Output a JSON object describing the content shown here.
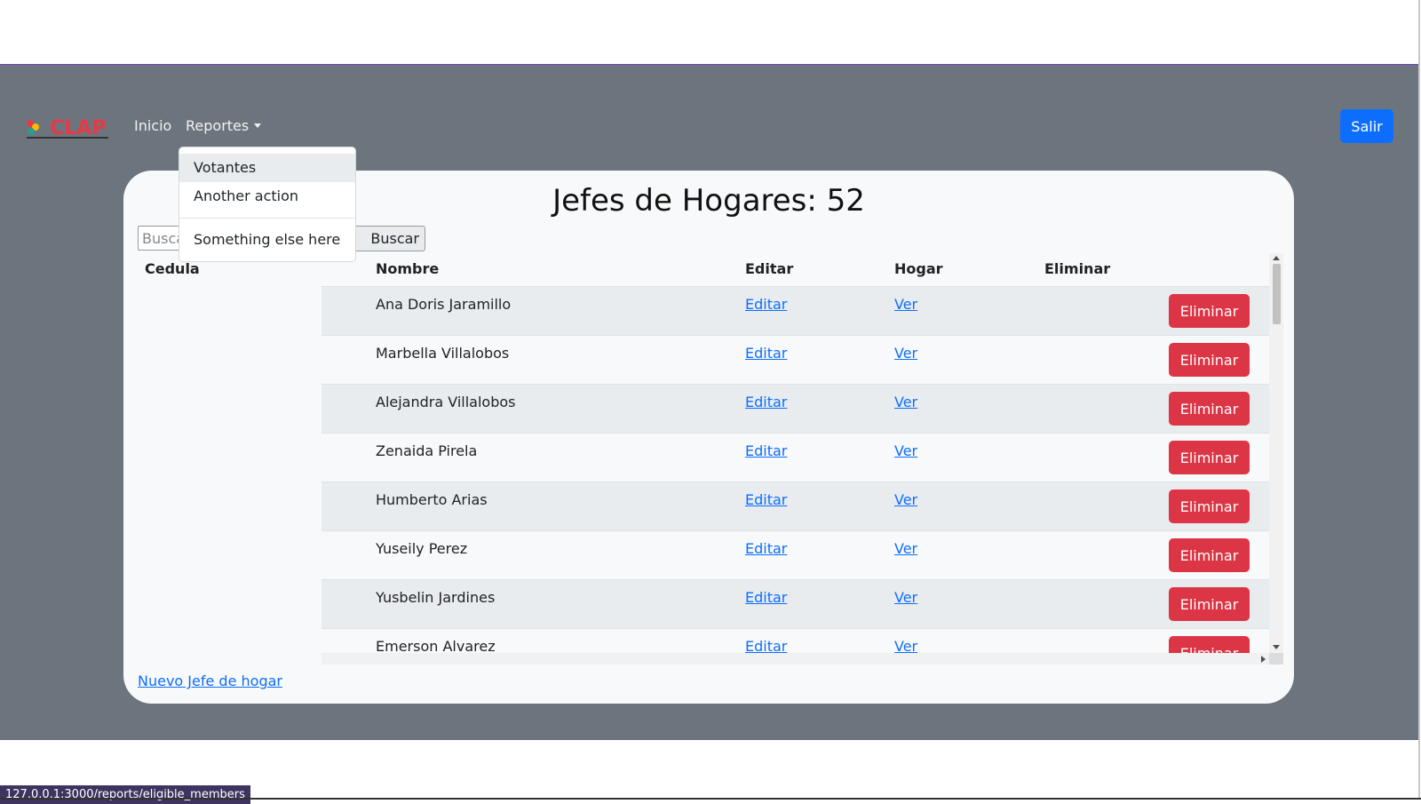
{
  "navbar": {
    "logo_text": "CLAP",
    "links": [
      {
        "label": "Inicio"
      },
      {
        "label": "Reportes"
      }
    ],
    "logout_label": "Salir"
  },
  "dropdown": {
    "items": [
      {
        "label": "Votantes"
      },
      {
        "label": "Another action"
      },
      {
        "label": "Something else here"
      }
    ]
  },
  "main": {
    "title": "Jefes de Hogares: 52",
    "search_placeholder": "Buscar",
    "search_button_label": "Buscar",
    "new_link_label": "Nuevo Jefe de hogar"
  },
  "table": {
    "columns": [
      "Cedula",
      "Nombre",
      "Editar",
      "Hogar",
      "Eliminar"
    ],
    "rows": [
      {
        "cedula": "",
        "nombre": "Ana Doris Jaramillo",
        "editar": "Editar",
        "hogar": "Ver",
        "eliminar": "Eliminar"
      },
      {
        "cedula": "",
        "nombre": "Marbella Villalobos",
        "editar": "Editar",
        "hogar": "Ver",
        "eliminar": "Eliminar"
      },
      {
        "cedula": "",
        "nombre": "Alejandra Villalobos",
        "editar": "Editar",
        "hogar": "Ver",
        "eliminar": "Eliminar"
      },
      {
        "cedula": "",
        "nombre": "Zenaida Pirela",
        "editar": "Editar",
        "hogar": "Ver",
        "eliminar": "Eliminar"
      },
      {
        "cedula": "",
        "nombre": "Humberto Arias",
        "editar": "Editar",
        "hogar": "Ver",
        "eliminar": "Eliminar"
      },
      {
        "cedula": "",
        "nombre": "Yuseily Perez",
        "editar": "Editar",
        "hogar": "Ver",
        "eliminar": "Eliminar"
      },
      {
        "cedula": "",
        "nombre": "Yusbelin Jardines",
        "editar": "Editar",
        "hogar": "Ver",
        "eliminar": "Eliminar"
      },
      {
        "cedula": "",
        "nombre": "Emerson Alvarez",
        "editar": "Editar",
        "hogar": "Ver",
        "eliminar": "Eliminar"
      }
    ]
  },
  "status_bar": {
    "url": "127.0.0.1:3000/reports/eligible_members"
  },
  "colors": {
    "background": "#6c757d",
    "card": "#f8f9fa",
    "primary": "#0d6efd",
    "danger": "#dc3545"
  }
}
